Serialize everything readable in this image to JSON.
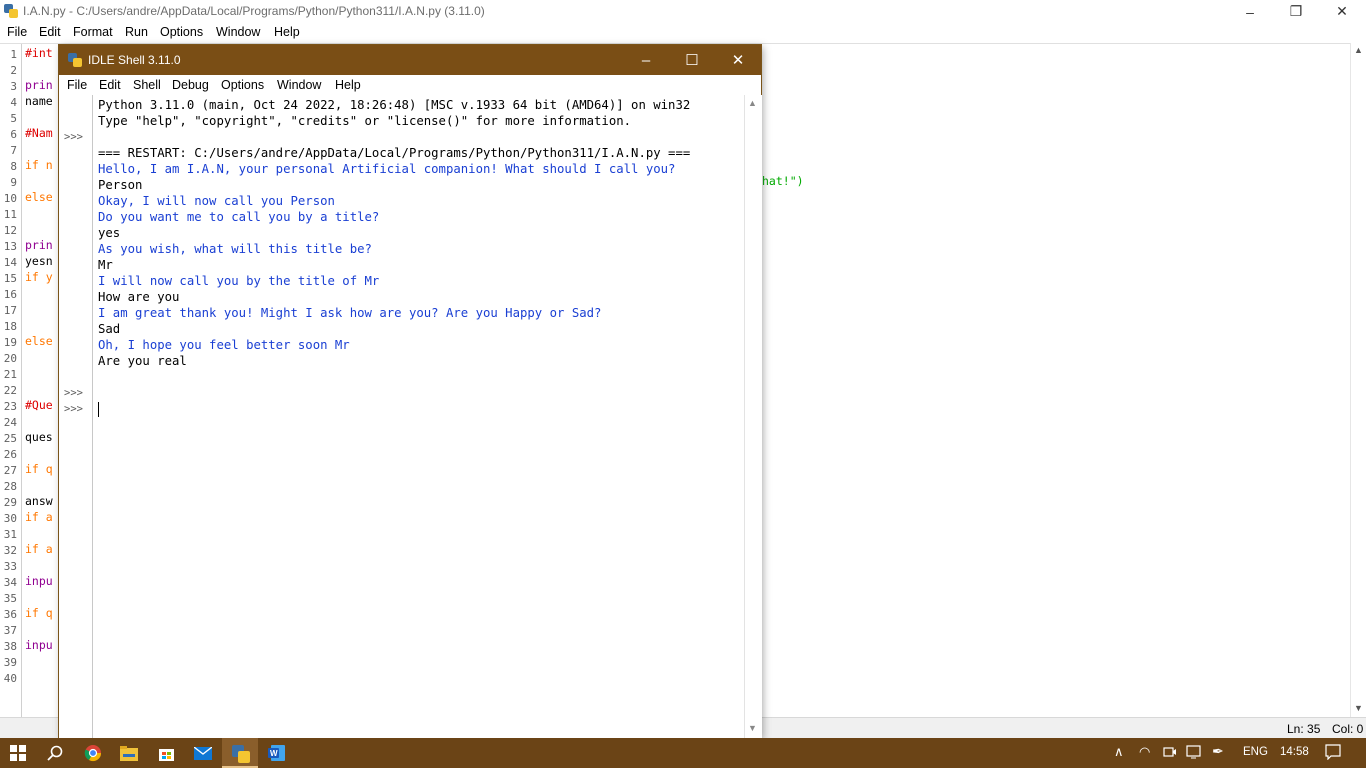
{
  "editor": {
    "title": "I.A.N.py - C:/Users/andre/AppData/Local/Programs/Python/Python311/I.A.N.py (3.11.0)",
    "menu": [
      "File",
      "Edit",
      "Format",
      "Run",
      "Options",
      "Window",
      "Help"
    ],
    "line_numbers": [
      "1",
      "2",
      "3",
      "4",
      "5",
      "6",
      "7",
      "8",
      "9",
      "10",
      "11",
      "12",
      "13",
      "14",
      "15",
      "16",
      "17",
      "18",
      "19",
      "20",
      "21",
      "22",
      "23",
      "24",
      "25",
      "26",
      "27",
      "28",
      "29",
      "30",
      "31",
      "32",
      "33",
      "34",
      "35",
      "36",
      "37",
      "38",
      "39",
      "40"
    ],
    "visible_code": {
      "l1": "#int",
      "l3": "prin",
      "l4": "name",
      "l6": "#Nam",
      "l8": "if n",
      "l10": "else",
      "l13": "prin",
      "l14": "yesn",
      "l15": "if y",
      "l19": "else",
      "l23": "#Que",
      "l25": "ques",
      "l27": "if q",
      "l29": "answ",
      "l30": "if a",
      "l32": "if a",
      "l34": "inpu",
      "l36": "if q",
      "l38": "inpu",
      "l9_right": "hat!\")"
    },
    "status": {
      "ln": "Ln: 35",
      "col": "Col: 0"
    }
  },
  "shell": {
    "title": "IDLE Shell 3.11.0",
    "menu": [
      "File",
      "Edit",
      "Shell",
      "Debug",
      "Options",
      "Window",
      "Help"
    ],
    "prompts": [
      ">>>",
      ">>>",
      ">>>"
    ],
    "lines": [
      {
        "text": "Python 3.11.0 (main, Oct 24 2022, 18:26:48) [MSC v.1933 64 bit (AMD64)] on win32",
        "style": "out"
      },
      {
        "text": "Type \"help\", \"copyright\", \"credits\" or \"license()\" for more information.",
        "style": "out"
      },
      {
        "text": "",
        "style": "out"
      },
      {
        "text": "=== RESTART: C:/Users/andre/AppData/Local/Programs/Python/Python311/I.A.N.py ===",
        "style": "out"
      },
      {
        "text": "Hello, I am I.A.N, your personal Artificial companion! What should I call you?",
        "style": "blue"
      },
      {
        "text": "Person",
        "style": "out"
      },
      {
        "text": "Okay, I will now call you Person",
        "style": "blue"
      },
      {
        "text": "Do you want me to call you by a title?",
        "style": "blue"
      },
      {
        "text": "yes",
        "style": "out"
      },
      {
        "text": "As you wish, what will this title be?",
        "style": "blue"
      },
      {
        "text": "Mr",
        "style": "out"
      },
      {
        "text": "I will now call you by the title of Mr",
        "style": "blue"
      },
      {
        "text": "How are you",
        "style": "out"
      },
      {
        "text": "I am great thank you! Might I ask how are you? Are you Happy or Sad?",
        "style": "blue"
      },
      {
        "text": "Sad",
        "style": "out"
      },
      {
        "text": "Oh, I hope you feel better soon Mr",
        "style": "blue"
      },
      {
        "text": "Are you real",
        "style": "out"
      }
    ]
  },
  "taskbar": {
    "language": "ENG",
    "time": "14:58"
  },
  "icons": {
    "start": "windows-start-icon",
    "search": "search-icon",
    "chrome": "chrome-icon",
    "explorer": "file-explorer-icon",
    "store": "store-icon",
    "mail": "mail-icon",
    "python": "python-idle-icon",
    "word": "word-icon"
  }
}
